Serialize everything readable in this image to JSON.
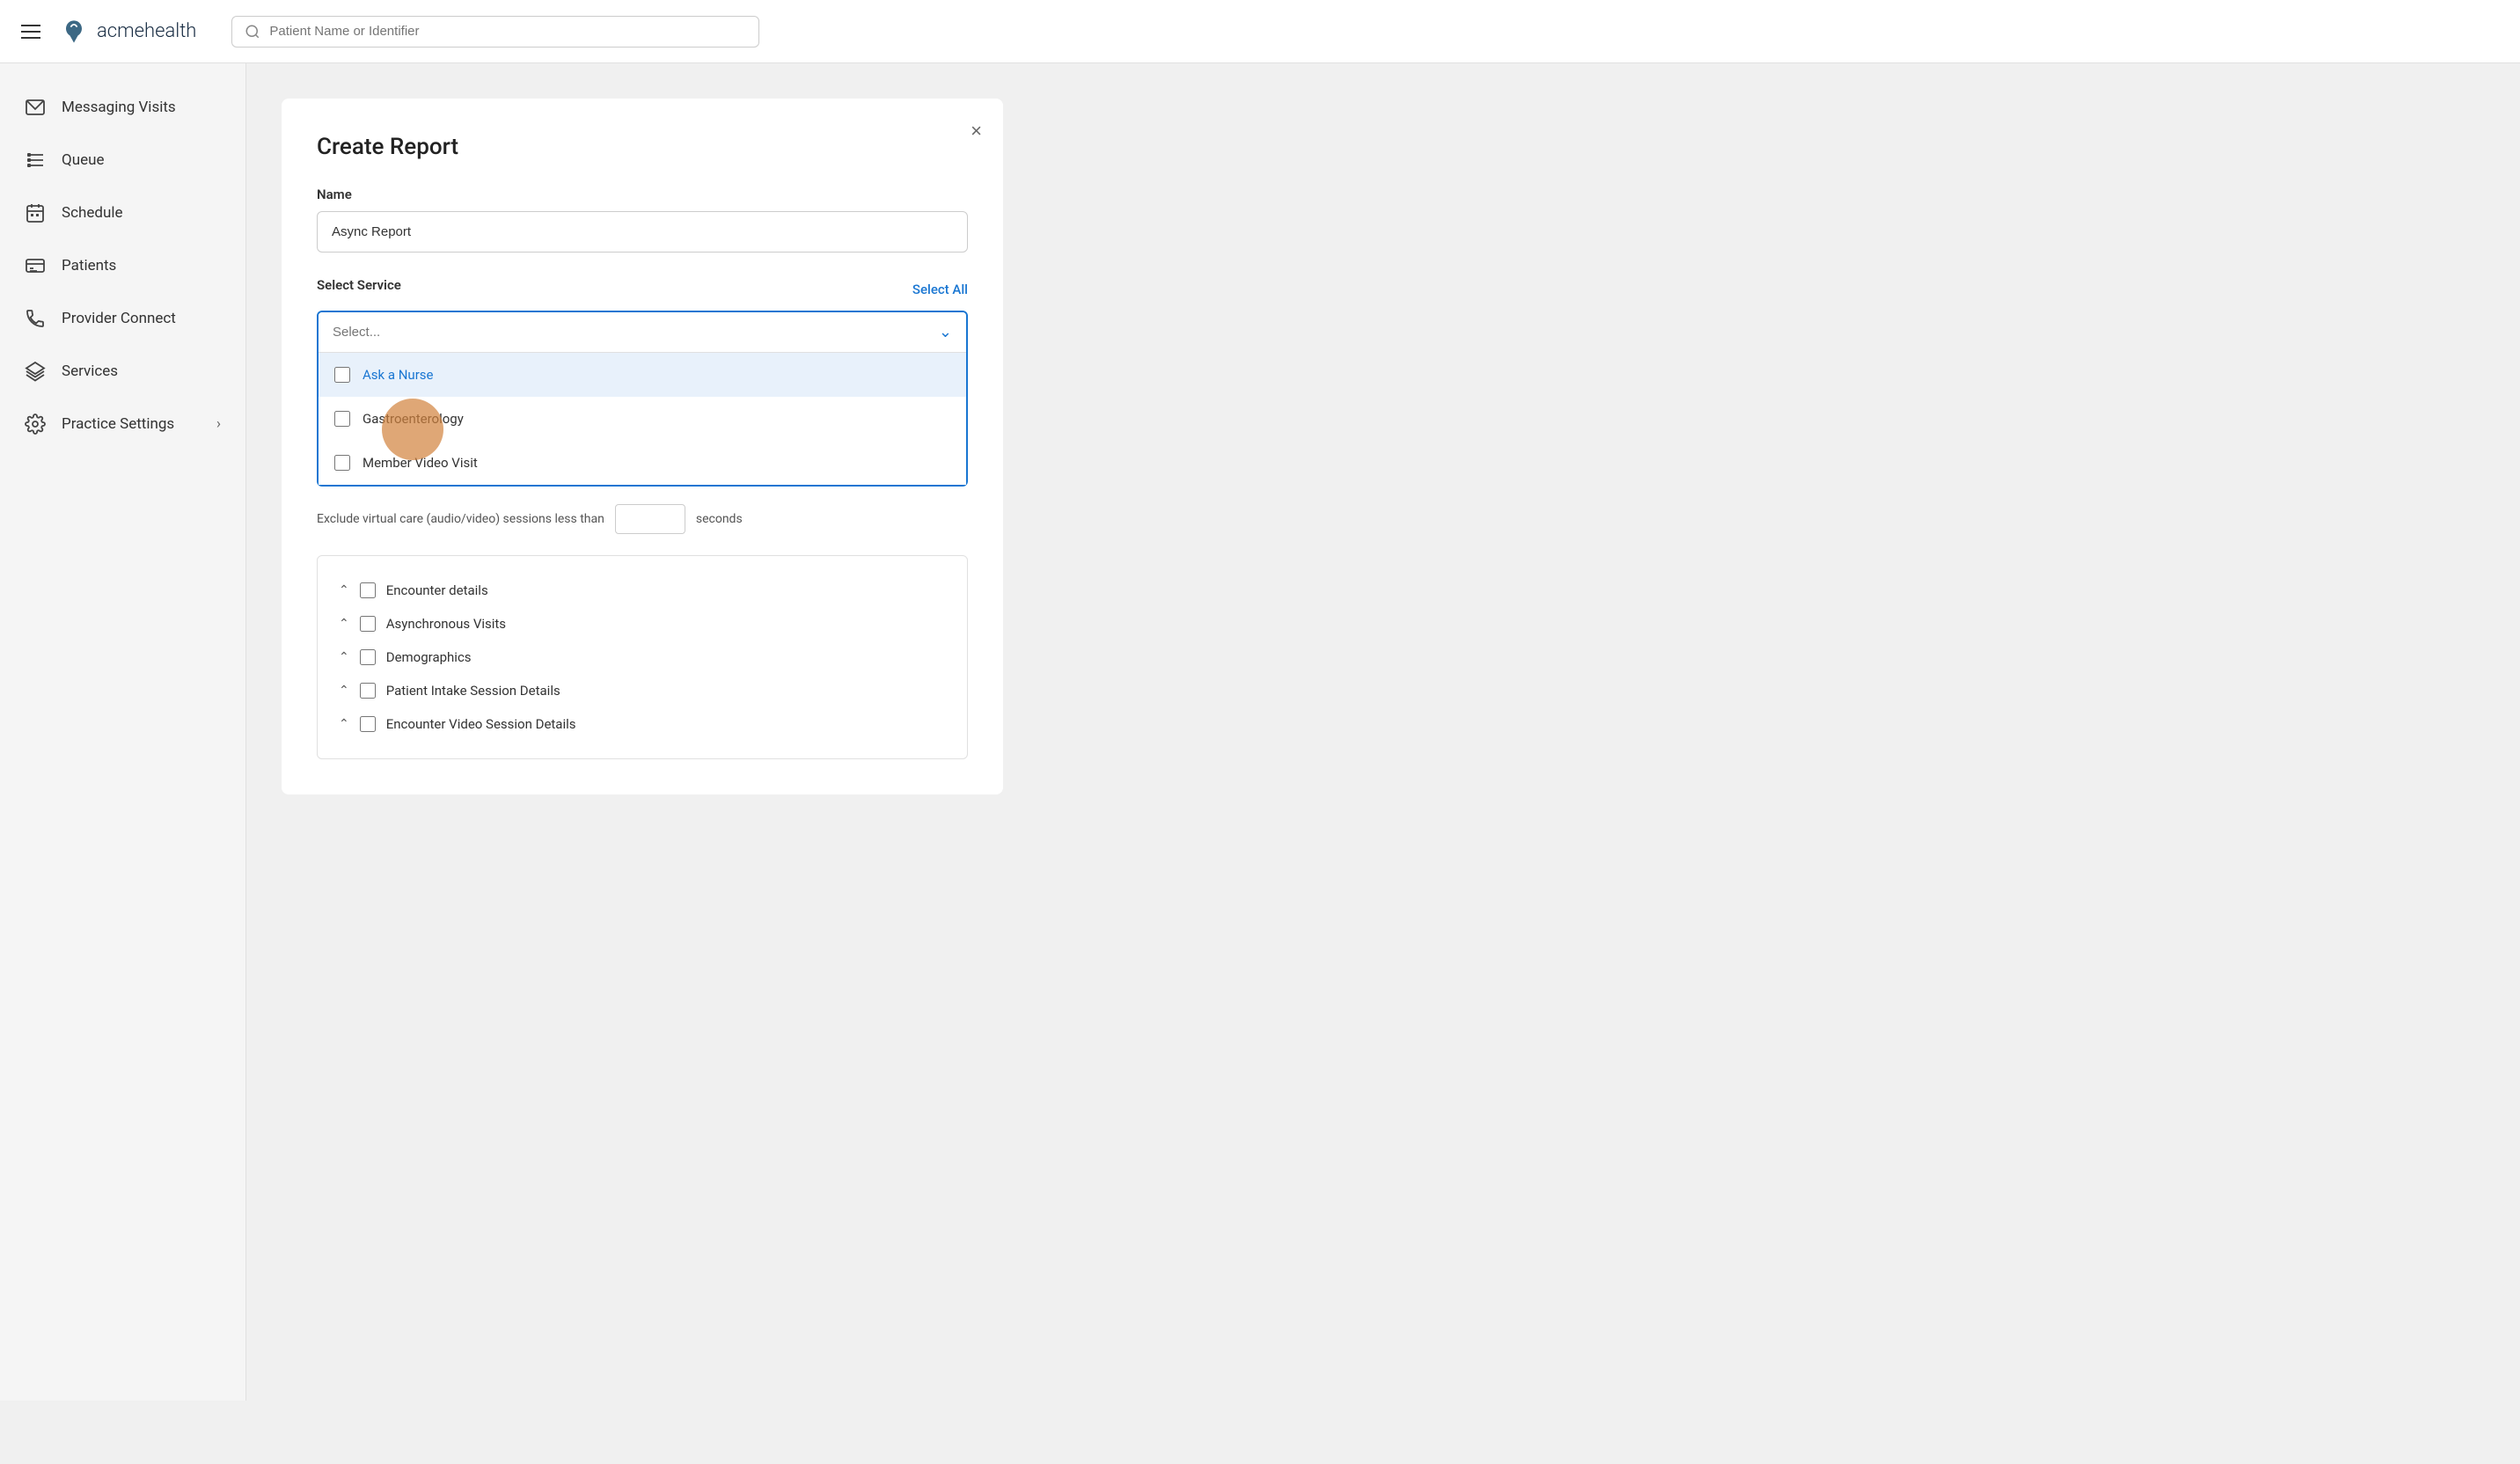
{
  "header": {
    "hamburger_label": "menu",
    "logo_text_bold": "acme",
    "logo_text_light": "health",
    "search_placeholder": "Patient Name or Identifier"
  },
  "sidebar": {
    "items": [
      {
        "id": "messaging-visits",
        "label": "Messaging Visits",
        "icon": "envelope"
      },
      {
        "id": "queue",
        "label": "Queue",
        "icon": "list"
      },
      {
        "id": "schedule",
        "label": "Schedule",
        "icon": "calendar"
      },
      {
        "id": "patients",
        "label": "Patients",
        "icon": "card"
      },
      {
        "id": "provider-connect",
        "label": "Provider Connect",
        "icon": "phone"
      },
      {
        "id": "services",
        "label": "Services",
        "icon": "layers"
      },
      {
        "id": "practice-settings",
        "label": "Practice Settings",
        "icon": "gear",
        "has_chevron": true
      }
    ]
  },
  "panel": {
    "title": "Create Report",
    "close_label": "×",
    "name_label": "Name",
    "name_value": "Async Report",
    "select_service_label": "Select Service",
    "select_all_label": "Select All",
    "select_placeholder": "Select...",
    "dropdown_items": [
      {
        "id": "ask-nurse",
        "label": "Ask a Nurse",
        "checked": false,
        "highlighted": true
      },
      {
        "id": "gastroenterology",
        "label": "Gastroenterology",
        "checked": false
      },
      {
        "id": "member-video-visit",
        "label": "Member Video Visit",
        "checked": false
      }
    ],
    "exclude_text_before": "Exclude virtual care (audio/video) sessions less than",
    "exclude_text_after": "seconds",
    "exclude_value": "",
    "checkbox_sections": [
      {
        "id": "encounter-details",
        "label": "Encounter details"
      },
      {
        "id": "async-visits",
        "label": "Asynchronous Visits"
      },
      {
        "id": "demographics",
        "label": "Demographics"
      },
      {
        "id": "patient-intake",
        "label": "Patient Intake Session Details"
      },
      {
        "id": "encounter-video",
        "label": "Encounter Video Session Details"
      }
    ]
  }
}
